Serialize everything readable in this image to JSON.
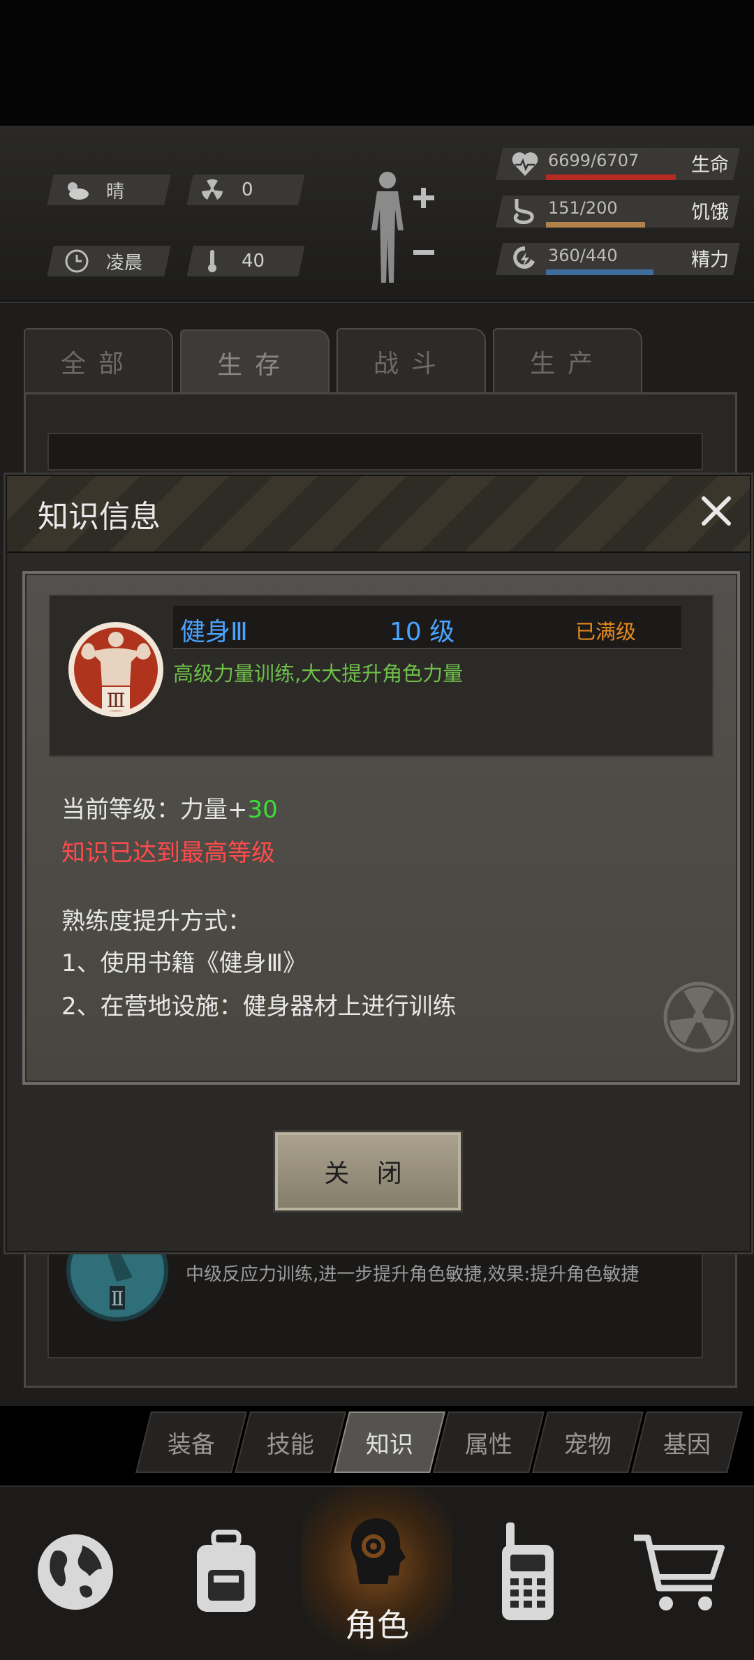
{
  "status": {
    "weather": {
      "icon": "cloud-sun-icon",
      "label": "晴"
    },
    "radiation": {
      "icon": "radiation-icon",
      "value": "0"
    },
    "time": {
      "icon": "clock-icon",
      "label": "凌晨"
    },
    "temperature": {
      "icon": "thermometer-icon",
      "value": "40"
    },
    "vitals": [
      {
        "icon": "heart-icon",
        "value": "6699/6707",
        "label": "生命",
        "fill": 0.999,
        "color": "#b62a22"
      },
      {
        "icon": "stomach-icon",
        "value": "151/200",
        "label": "饥饿",
        "fill": 0.755,
        "color": "#b0824a"
      },
      {
        "icon": "energy-icon",
        "value": "360/440",
        "label": "精力",
        "fill": 0.818,
        "color": "#3f6d9e"
      }
    ]
  },
  "tabs": [
    {
      "label": "全部"
    },
    {
      "label": "生存"
    },
    {
      "label": "战斗"
    },
    {
      "label": "生产"
    }
  ],
  "background_list": {
    "item_desc": "中级反应力训练,进一步提升角色敏捷,效果:提升角色敏捷"
  },
  "modal": {
    "title": "知识信息",
    "skill": {
      "name": "健身Ⅲ",
      "level": "10 级",
      "status": "已满级",
      "description": "高级力量训练,大大提升角色力量"
    },
    "current_level_label": "当前等级：力量+",
    "current_level_bonus": "30",
    "max_notice": "知识已达到最高等级",
    "method_title": "熟练度提升方式：",
    "methods": [
      "1、使用书籍《健身Ⅲ》",
      "2、在营地设施：健身器材上进行训练"
    ],
    "close_button": "关 闭"
  },
  "sub_tabs": [
    {
      "label": "装备"
    },
    {
      "label": "技能"
    },
    {
      "label": "知识"
    },
    {
      "label": "属性"
    },
    {
      "label": "宠物"
    },
    {
      "label": "基因"
    }
  ],
  "bottom_nav": [
    {
      "icon": "globe-icon",
      "label": ""
    },
    {
      "icon": "backpack-icon",
      "label": ""
    },
    {
      "icon": "character-head-icon",
      "label": "角色"
    },
    {
      "icon": "walkie-talkie-icon",
      "label": ""
    },
    {
      "icon": "shopping-cart-icon",
      "label": ""
    }
  ]
}
